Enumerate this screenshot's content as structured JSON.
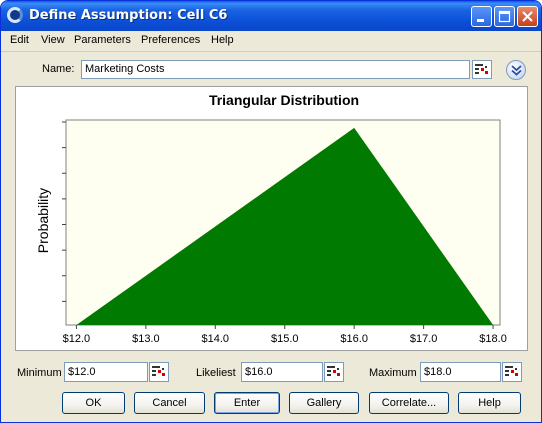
{
  "window": {
    "title": "Define Assumption: Cell C6"
  },
  "menu": [
    "Edit",
    "View",
    "Parameters",
    "Preferences",
    "Help"
  ],
  "name": {
    "label": "Name:",
    "value": "Marketing Costs"
  },
  "chart_data": {
    "type": "area",
    "title": "Triangular Distribution",
    "xlabel": "",
    "ylabel": "Probability",
    "x_tick_labels": [
      "$12.0",
      "$13.0",
      "$14.0",
      "$15.0",
      "$16.0",
      "$17.0",
      "$18.0"
    ],
    "x": [
      12.0,
      16.0,
      18.0
    ],
    "y": [
      0,
      1,
      0
    ],
    "xlim": [
      11.85,
      18.1
    ],
    "ylim": [
      0,
      1.04
    ],
    "grid": false,
    "colors": {
      "fill": "#007a00",
      "plot_bg": "#fefff0"
    }
  },
  "params": {
    "minimum": {
      "label": "Minimum",
      "value": "$12.0"
    },
    "likeliest": {
      "label": "Likeliest",
      "value": "$16.0"
    },
    "maximum": {
      "label": "Maximum",
      "value": "$18.0"
    }
  },
  "buttons": {
    "ok": "OK",
    "cancel": "Cancel",
    "enter": "Enter",
    "gallery": "Gallery",
    "correlate": "Correlate...",
    "help": "Help"
  }
}
